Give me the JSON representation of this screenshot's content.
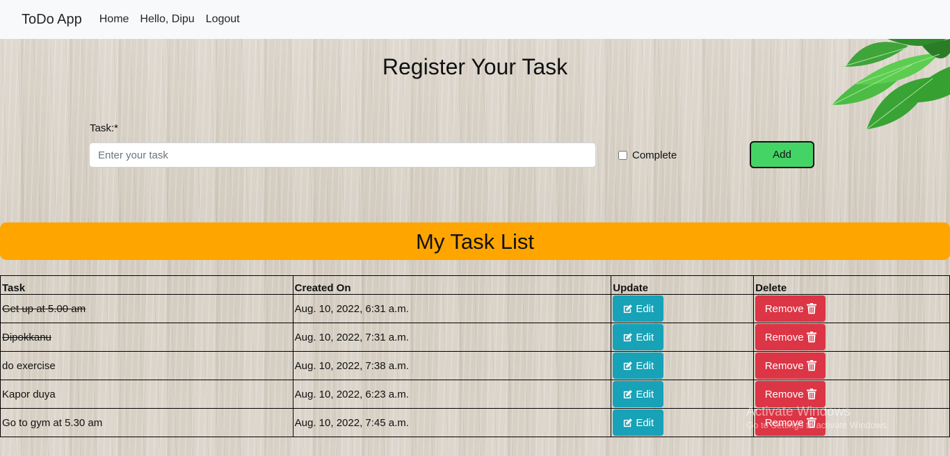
{
  "navbar": {
    "brand": "ToDo App",
    "links": [
      "Home",
      "Hello, Dipu",
      "Logout"
    ]
  },
  "register": {
    "title": "Register Your Task",
    "task_label": "Task:*",
    "task_placeholder": "Enter your task",
    "task_value": "",
    "complete_label": "Complete",
    "complete_checked": false,
    "add_label": "Add"
  },
  "task_list": {
    "title": "My Task List",
    "headers": [
      "Task",
      "Created On",
      "Update",
      "Delete"
    ],
    "edit_label": "Edit",
    "remove_label": "Remove",
    "rows": [
      {
        "task": "Get up at 5.00 am",
        "created": "Aug. 10, 2022, 6:31 a.m.",
        "complete": true
      },
      {
        "task": "Dipokkanu",
        "created": "Aug. 10, 2022, 7:31 a.m.",
        "complete": true
      },
      {
        "task": "do exercise",
        "created": "Aug. 10, 2022, 7:38 a.m.",
        "complete": false
      },
      {
        "task": "Kapor duya",
        "created": "Aug. 10, 2022, 6:23 a.m.",
        "complete": false
      },
      {
        "task": "Go to gym at 5.30 am",
        "created": "Aug. 10, 2022, 7:45 a.m.",
        "complete": false
      }
    ]
  },
  "watermark": {
    "line1": "Activate Windows",
    "line2": "Go to Settings to activate Windows."
  },
  "colors": {
    "banner": "#ffa500",
    "add_button": "#44d466",
    "edit_button": "#17a2b8",
    "remove_button": "#dc3545"
  },
  "icons": {
    "edit": "edit-square-icon",
    "remove": "trash-icon"
  }
}
